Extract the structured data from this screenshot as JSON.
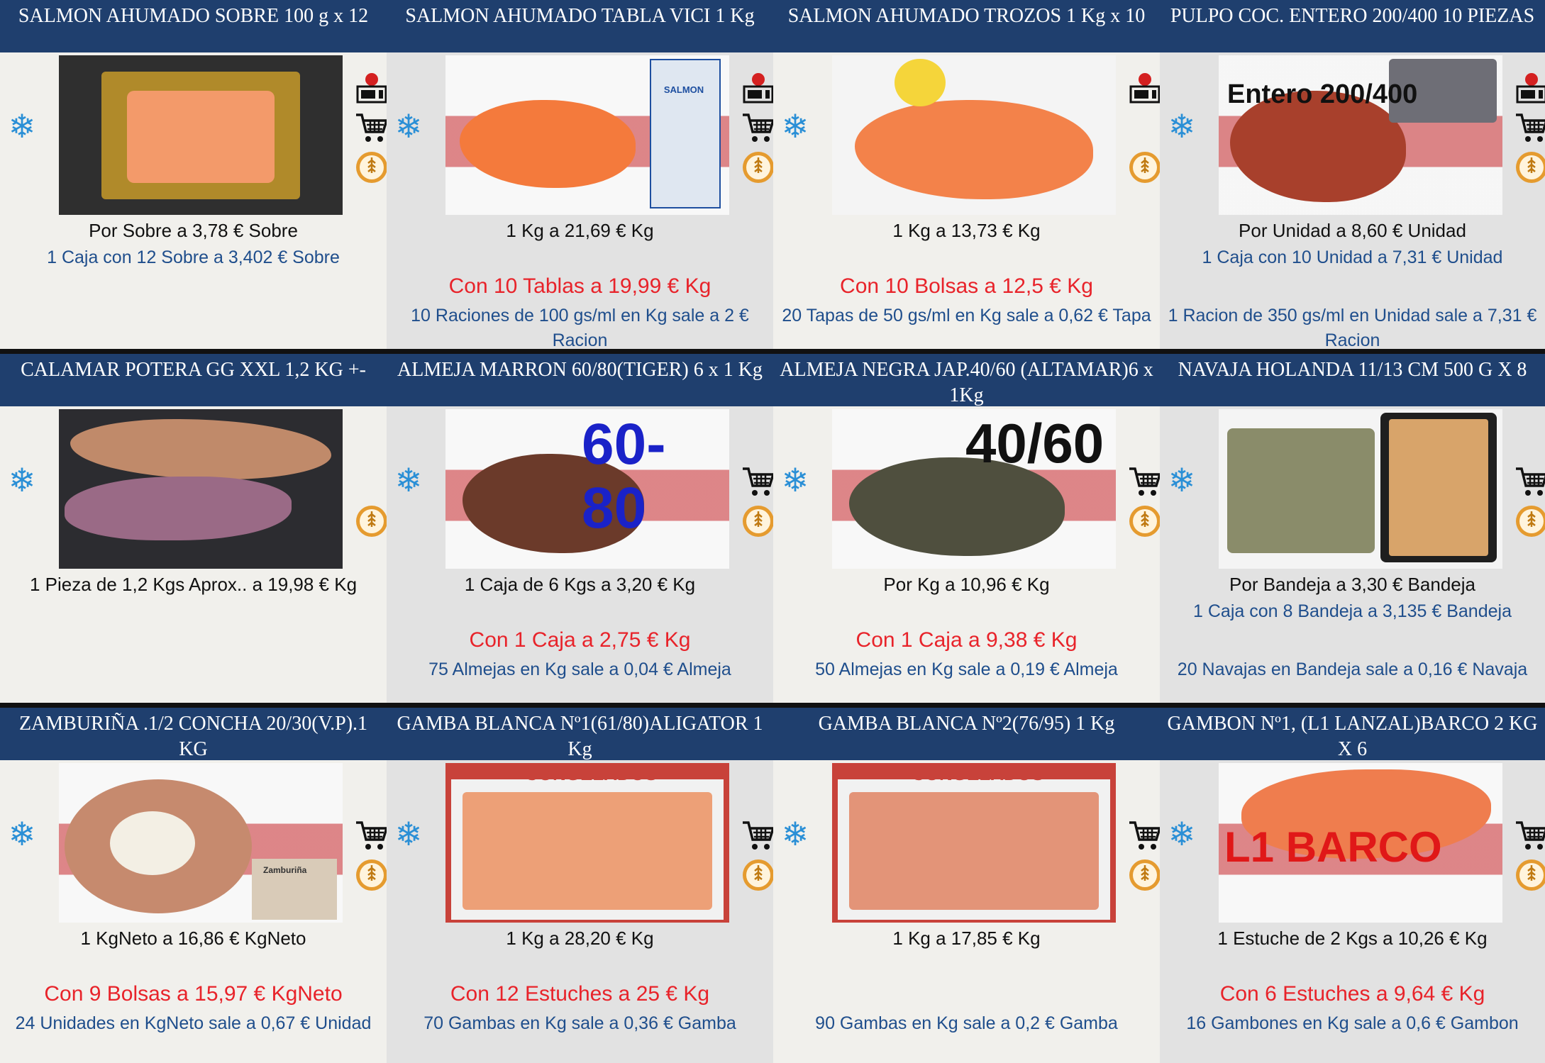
{
  "colors": {
    "header_bg": "#1f3f6e",
    "offer_red": "#e8232a",
    "link_blue": "#1f4e8c",
    "snow_blue": "#2a8fd6"
  },
  "products": [
    {
      "title": "SALMON AHUMADO SOBRE 100 g x 12",
      "photo_text": "",
      "price": "Por Sobre a 3,78 € Sobre",
      "box": "1 Caja con 12 Sobre a 3,402 € Sobre",
      "offer": "",
      "ration": "",
      "icons": [
        "snowflake-icon",
        "microwave-icon",
        "cart-icon",
        "gluten-free-icon"
      ]
    },
    {
      "title": "SALMON AHUMADO TABLA VICI 1 Kg",
      "photo_text": "SALMON",
      "price": "1 Kg a 21,69 € Kg",
      "box": "",
      "offer": "Con   10 Tablas a 19,99 € Kg",
      "ration": "10 Raciones de 100 gs/ml  en Kg sale a 2 € Racion",
      "icons": [
        "snowflake-icon",
        "microwave-icon",
        "cart-icon",
        "gluten-free-icon"
      ]
    },
    {
      "title": "SALMON AHUMADO TROZOS 1 Kg x 10",
      "photo_text": "",
      "price": "1 Kg a 13,73 € Kg",
      "box": "",
      "offer": "Con   10 Bolsas a 12,5 € Kg",
      "ration": "20 Tapas de 50 gs/ml  en Kg sale a 0,62 € Tapa",
      "icons": [
        "snowflake-icon",
        "microwave-icon",
        "cart-icon",
        "gluten-free-icon"
      ]
    },
    {
      "title": "PULPO COC. ENTERO 200/400 10 PIEZAS",
      "photo_text": "Entero 200/400",
      "price": "Por Unidad a 8,60 € Unidad",
      "box": "1 Caja con 10 Unidad a 7,31 € Unidad",
      "offer": "",
      "ration": "1 Racion de 350 gs/ml  en Unidad sale a 7,31 € Racion",
      "icons": [
        "snowflake-icon",
        "microwave-icon",
        "cart-icon",
        "gluten-free-icon"
      ]
    },
    {
      "title": "CALAMAR POTERA GG XXL 1,2 KG +-",
      "photo_text": "",
      "price": "1 Pieza de 1,2 Kgs Aprox.. a 19,98 € Kg",
      "box": "",
      "offer": "",
      "ration": "",
      "icons": [
        "snowflake-icon",
        "gluten-free-icon"
      ]
    },
    {
      "title": "ALMEJA MARRON 60/80(TIGER) 6 x 1 Kg",
      "photo_text": "60-80",
      "price": "1 Caja de 6 Kgs a 3,20 € Kg",
      "box": "",
      "offer": "Con   1 Caja a 2,75 € Kg",
      "ration": "75 Almejas  en Kg sale a 0,04 € Almeja",
      "icons": [
        "snowflake-icon",
        "cart-icon",
        "gluten-free-icon"
      ]
    },
    {
      "title": "ALMEJA NEGRA JAP.40/60 (ALTAMAR)6 x 1Kg",
      "photo_text": "40/60",
      "price": "Por Kg a 10,96 € Kg",
      "box": "",
      "offer": "Con   1 Caja a 9,38 € Kg",
      "ration": "50 Almejas  en Kg sale a 0,19 € Almeja",
      "icons": [
        "snowflake-icon",
        "cart-icon",
        "gluten-free-icon"
      ]
    },
    {
      "title": "NAVAJA HOLANDA 11/13 CM 500 G X 8",
      "photo_text": "",
      "price": "Por Bandeja a 3,30 € Bandeja",
      "box": "1 Caja con 8 Bandeja a 3,135 € Bandeja",
      "offer": "",
      "ration": "20 Navajas  en Bandeja sale a 0,16 € Navaja",
      "icons": [
        "snowflake-icon",
        "cart-icon",
        "gluten-free-icon"
      ]
    },
    {
      "title": "ZAMBURIÑA .1/2 CONCHA 20/30(V.P).1 KG",
      "photo_text": "Zamburiña",
      "price": "1 KgNeto a 16,86 € KgNeto",
      "box": "",
      "offer": "Con   9 Bolsas a 15,97 € KgNeto",
      "ration": "24 Unidades  en KgNeto sale a 0,67 € Unidad",
      "icons": [
        "snowflake-icon",
        "cart-icon",
        "gluten-free-icon"
      ]
    },
    {
      "title": "GAMBA BLANCA Nº1(61/80)ALIGATOR 1 Kg",
      "photo_text": "CONGELADOS",
      "price": "1 Kg a 28,20 € Kg",
      "box": "",
      "offer": "Con   12 Estuches a 25 € Kg",
      "ration": "70 Gambas  en Kg sale a 0,36 € Gamba",
      "icons": [
        "snowflake-icon",
        "cart-icon",
        "gluten-free-icon"
      ]
    },
    {
      "title": "GAMBA BLANCA Nº2(76/95) 1 Kg",
      "photo_text": "CONGELADOS",
      "price": "1 Kg a 17,85 € Kg",
      "box": "",
      "offer": "",
      "ration": "90 Gambas  en Kg sale a 0,2 € Gamba",
      "icons": [
        "snowflake-icon",
        "cart-icon",
        "gluten-free-icon"
      ]
    },
    {
      "title": "GAMBON Nº1, (L1 LANZAL)BARCO 2 KG X 6",
      "photo_text": "L1 BARCO",
      "price": "1 Estuche de 2 Kgs a 10,26 € Kg",
      "box": "",
      "offer": "Con   6 Estuches a 9,64 € Kg",
      "ration": "16 Gambones  en Kg sale a 0,6 € Gambon",
      "icons": [
        "snowflake-icon",
        "cart-icon",
        "gluten-free-icon"
      ]
    }
  ]
}
